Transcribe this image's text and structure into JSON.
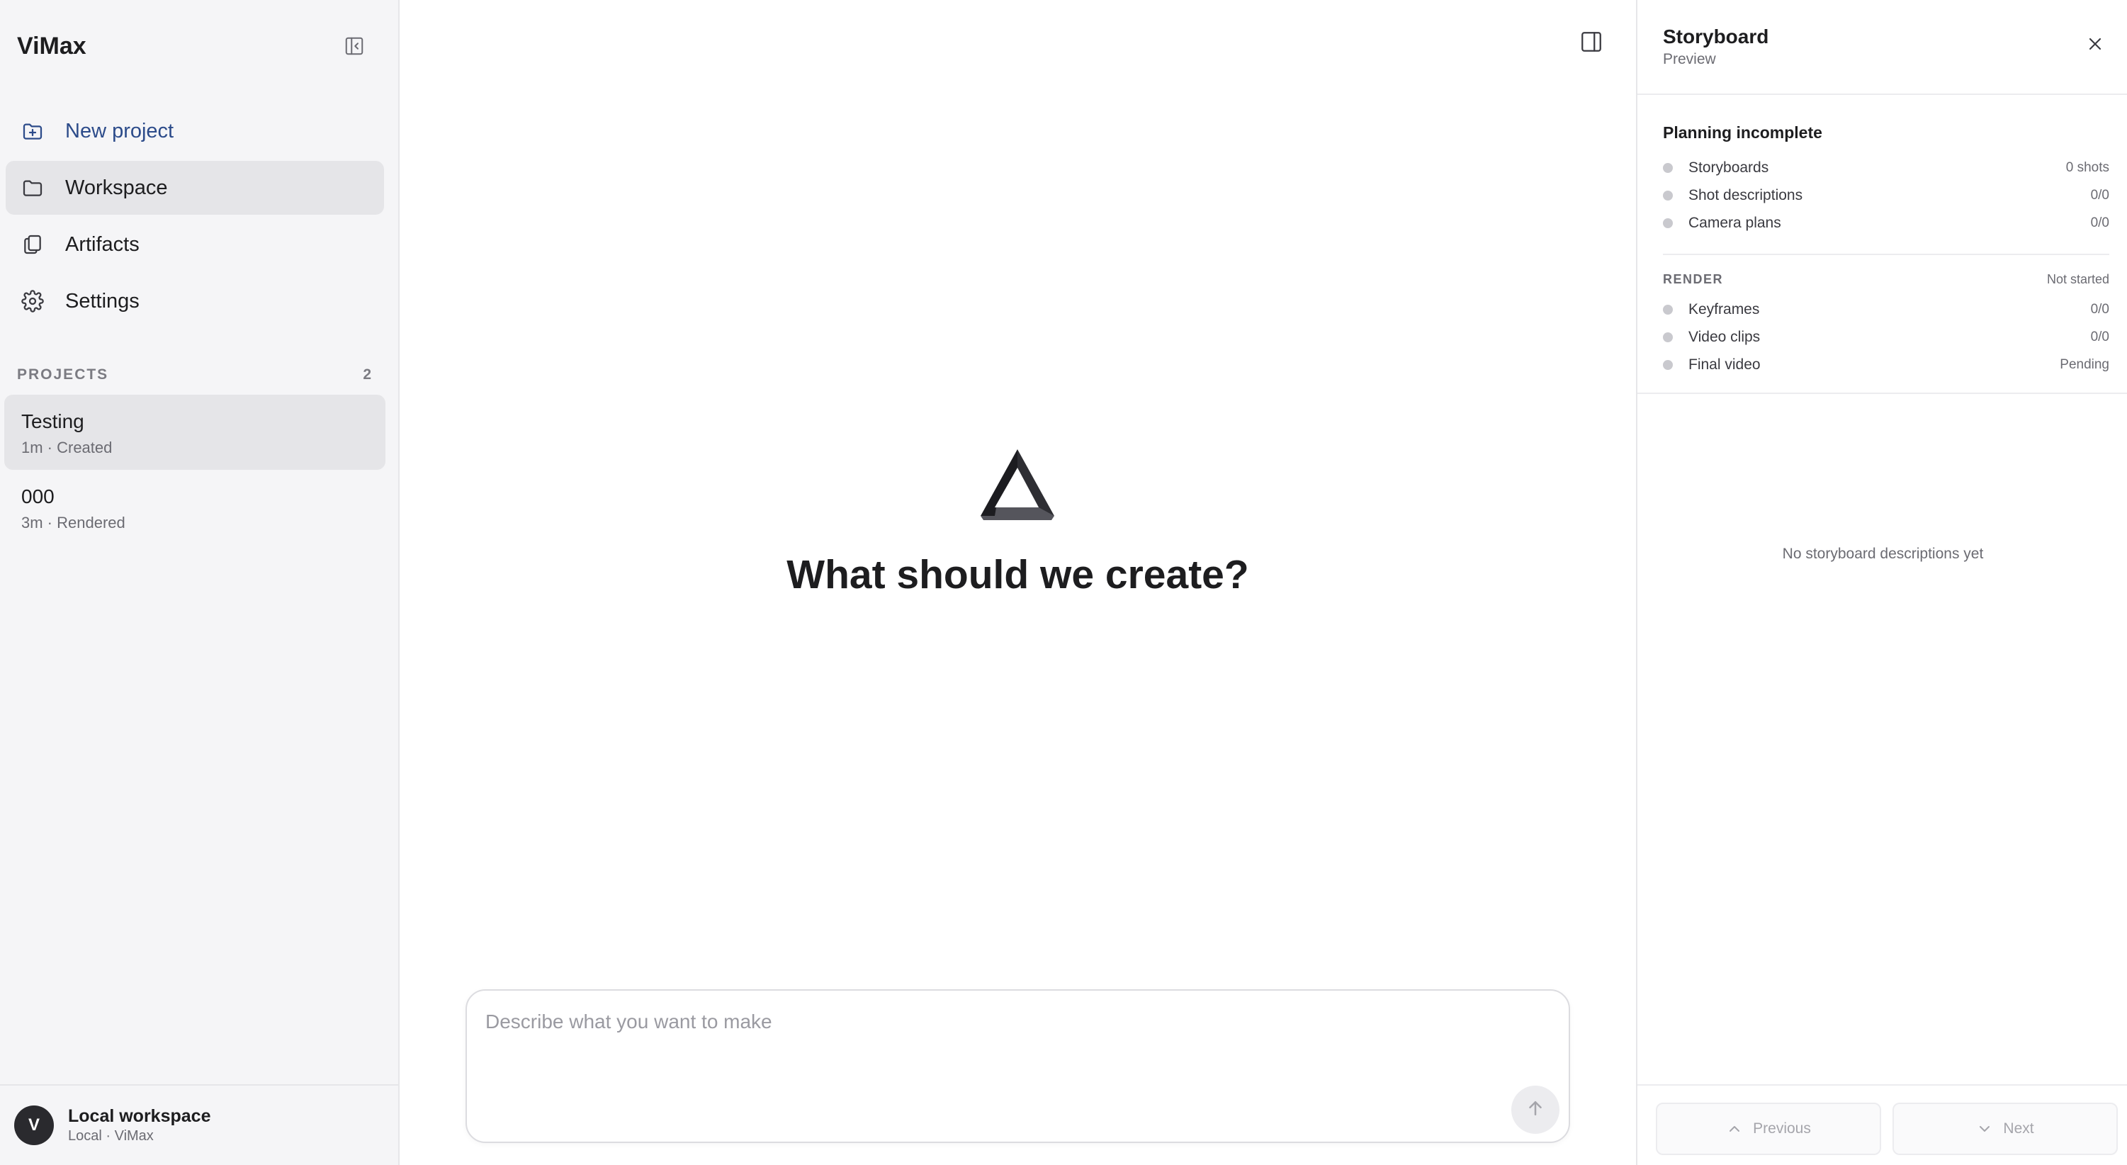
{
  "app": {
    "name": "ViMax"
  },
  "sidebar": {
    "nav": [
      {
        "label": "New project",
        "icon": "folder-plus-icon"
      },
      {
        "label": "Workspace",
        "icon": "folder-icon"
      },
      {
        "label": "Artifacts",
        "icon": "copy-icon"
      },
      {
        "label": "Settings",
        "icon": "gear-icon"
      }
    ],
    "projects_header": "PROJECTS",
    "projects_count": "2",
    "projects": [
      {
        "name": "Testing",
        "meta": "1m · Created"
      },
      {
        "name": "000",
        "meta": "3m · Rendered"
      }
    ],
    "account": {
      "initial": "V",
      "name": "Local workspace",
      "sub": "Local · ViMax"
    }
  },
  "main": {
    "title": "What should we create?",
    "composer_placeholder": "Describe what you want to make"
  },
  "panel": {
    "title": "Storyboard",
    "subtitle": "Preview",
    "planning": {
      "header": "Planning incomplete",
      "rows": [
        {
          "label": "Storyboards",
          "value": "0 shots"
        },
        {
          "label": "Shot descriptions",
          "value": "0/0"
        },
        {
          "label": "Camera plans",
          "value": "0/0"
        }
      ]
    },
    "render": {
      "header": "RENDER",
      "status": "Not started",
      "rows": [
        {
          "label": "Keyframes",
          "value": "0/0"
        },
        {
          "label": "Video clips",
          "value": "0/0"
        },
        {
          "label": "Final video",
          "value": "Pending"
        }
      ]
    },
    "empty_message": "No storyboard descriptions yet",
    "prev_label": "Previous",
    "next_label": "Next"
  },
  "colors": {
    "accent": "#2c4b8a",
    "sidebar_bg": "#f5f5f7",
    "active_bg": "#e5e5e8",
    "status_dot": "#c9c9ce"
  }
}
